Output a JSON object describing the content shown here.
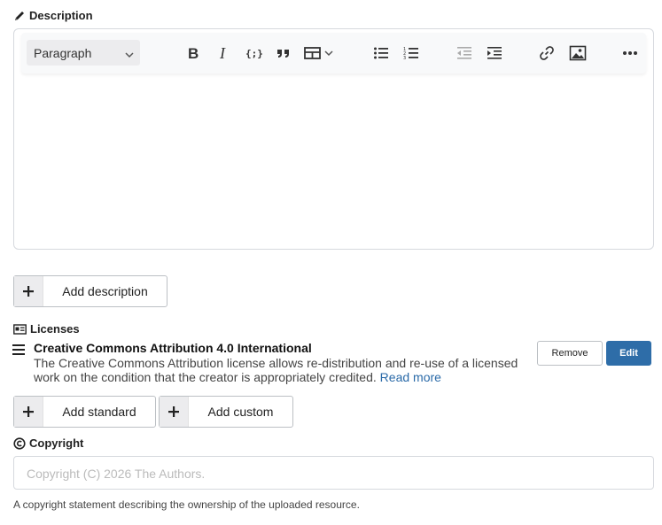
{
  "description": {
    "section_label": "Description",
    "icon": "pencil-icon",
    "toolbar": {
      "paragraph_select": "Paragraph",
      "buttons": [
        "bold-icon",
        "italic-icon",
        "code-block-icon",
        "quote-icon",
        "table-icon",
        "bulleted-list-icon",
        "numbered-list-icon",
        "outdent-icon",
        "indent-icon",
        "link-icon",
        "image-icon",
        "more-icon"
      ]
    },
    "add_button": "Add description"
  },
  "licenses": {
    "section_label": "Licenses",
    "icon": "id-card-icon",
    "items": [
      {
        "title": "Creative Commons Attribution 4.0 International",
        "description": "The Creative Commons Attribution license allows re-distribution and re-use of a licensed work on the condition that the creator is appropriately credited.",
        "read_more": "Read more",
        "remove_label": "Remove",
        "edit_label": "Edit"
      }
    ],
    "add_standard": "Add standard",
    "add_custom": "Add custom"
  },
  "copyright": {
    "section_label": "Copyright",
    "icon": "copyright-icon",
    "placeholder": "Copyright (C) 2026 The Authors.",
    "helper": "A copyright statement describing the ownership of the uploaded resource."
  },
  "colors": {
    "accent": "#2e6da8",
    "link": "#2a6aa8"
  }
}
